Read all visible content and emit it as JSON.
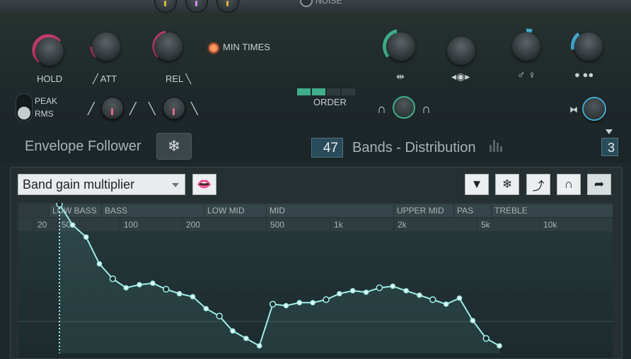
{
  "header": {
    "noise_label": "NOISE"
  },
  "controls": {
    "hold_label": "HOLD",
    "att_label": "ATT",
    "rel_label": "REL",
    "min_times_label": "MIN TIMES",
    "peak_label": "PEAK",
    "rms_label": "RMS",
    "order_label": "ORDER",
    "order_segments_on": 2,
    "order_segments_total": 4
  },
  "envelope": {
    "title": "Envelope Follower",
    "freeze_icon": "snowflake-icon"
  },
  "bands": {
    "count": "47",
    "title": "Bands - Distribution",
    "order_value": "3"
  },
  "graph_toolbar": {
    "mode_select": "Band gain multiplier",
    "lips_icon": "lips-icon",
    "buttons": [
      "chevron-down-icon",
      "snowflake-icon",
      "curve-icon",
      "magnet-icon",
      "arrow-right-icon"
    ]
  },
  "bands_row": [
    "LOW BASS",
    "BASS",
    "LOW MID",
    "MID",
    "UPPER MID",
    "PAS",
    "TREBLE"
  ],
  "freq_row": [
    "20",
    "50",
    "100",
    "200",
    "500",
    "1k",
    "2k",
    "5k",
    "10k"
  ],
  "colors": {
    "accent_green": "#3fae8a",
    "accent_pink": "#c23c6e",
    "accent_blue": "#41a9cf",
    "curve": "#9feee6"
  },
  "chart_data": {
    "type": "line",
    "ylim": [
      0,
      1
    ],
    "series": [
      {
        "values": [
          1.0,
          0.86,
          0.78,
          0.6,
          0.5,
          0.44,
          0.46,
          0.47,
          0.43,
          0.4,
          0.38,
          0.3,
          0.25,
          0.15,
          0.1,
          0.05,
          0.33,
          0.32,
          0.34,
          0.34,
          0.36,
          0.4,
          0.42,
          0.41,
          0.44,
          0.45,
          0.42,
          0.39,
          0.36,
          0.33,
          0.37,
          0.22,
          0.1,
          0.05
        ]
      }
    ]
  }
}
